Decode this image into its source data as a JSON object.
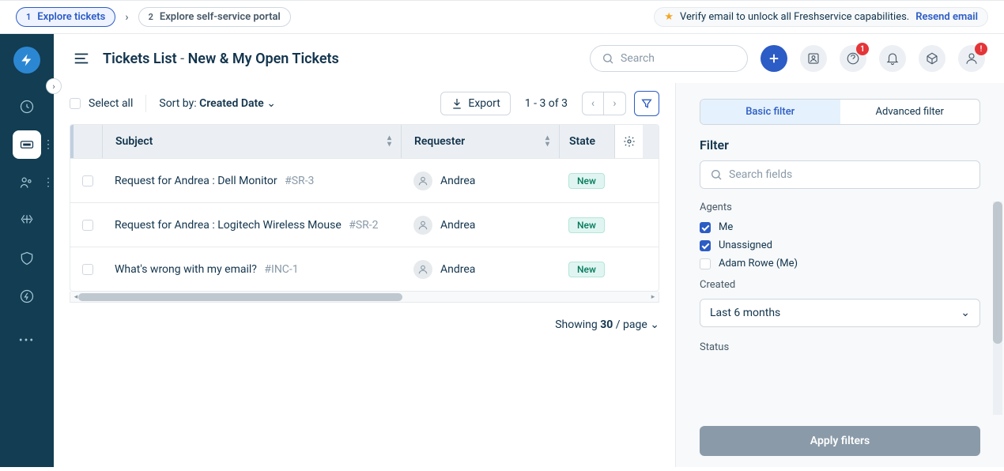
{
  "tour": {
    "step1_num": "1",
    "step1_label": "Explore tickets",
    "step2_num": "2",
    "step2_label": "Explore self-service portal"
  },
  "verify": {
    "text": "Verify email to unlock all Freshservice capabilities.",
    "link": "Resend email"
  },
  "header": {
    "title": "Tickets List",
    "subtitle": "New & My Open Tickets",
    "search_placeholder": "Search",
    "help_badge": "1",
    "avatar_badge": "!"
  },
  "toolbar": {
    "select_all": "Select all",
    "sort_by_label": "Sort by:",
    "sort_by_value": "Created Date",
    "export": "Export",
    "page_info": "1 - 3 of 3"
  },
  "table": {
    "headers": {
      "subject": "Subject",
      "requester": "Requester",
      "state": "State"
    },
    "rows": [
      {
        "subject": "Request for Andrea : Dell Monitor",
        "id": "#SR-3",
        "requester": "Andrea",
        "state": "New"
      },
      {
        "subject": "Request for Andrea : Logitech Wireless Mouse",
        "id": "#SR-2",
        "requester": "Andrea",
        "state": "New"
      },
      {
        "subject": "What's wrong with my email?",
        "id": "#INC-1",
        "requester": "Andrea",
        "state": "New"
      }
    ]
  },
  "footer": {
    "showing": "Showing ",
    "per_page": "30",
    "per_page_suffix": " / page"
  },
  "filter": {
    "tabs": {
      "basic": "Basic filter",
      "advanced": "Advanced filter"
    },
    "heading": "Filter",
    "search_placeholder": "Search fields",
    "agents_label": "Agents",
    "agents": [
      {
        "label": "Me",
        "checked": true
      },
      {
        "label": "Unassigned",
        "checked": true
      },
      {
        "label": "Adam Rowe (Me)",
        "checked": false
      }
    ],
    "created_label": "Created",
    "created_value": "Last 6 months",
    "status_label": "Status",
    "apply": "Apply filters"
  }
}
